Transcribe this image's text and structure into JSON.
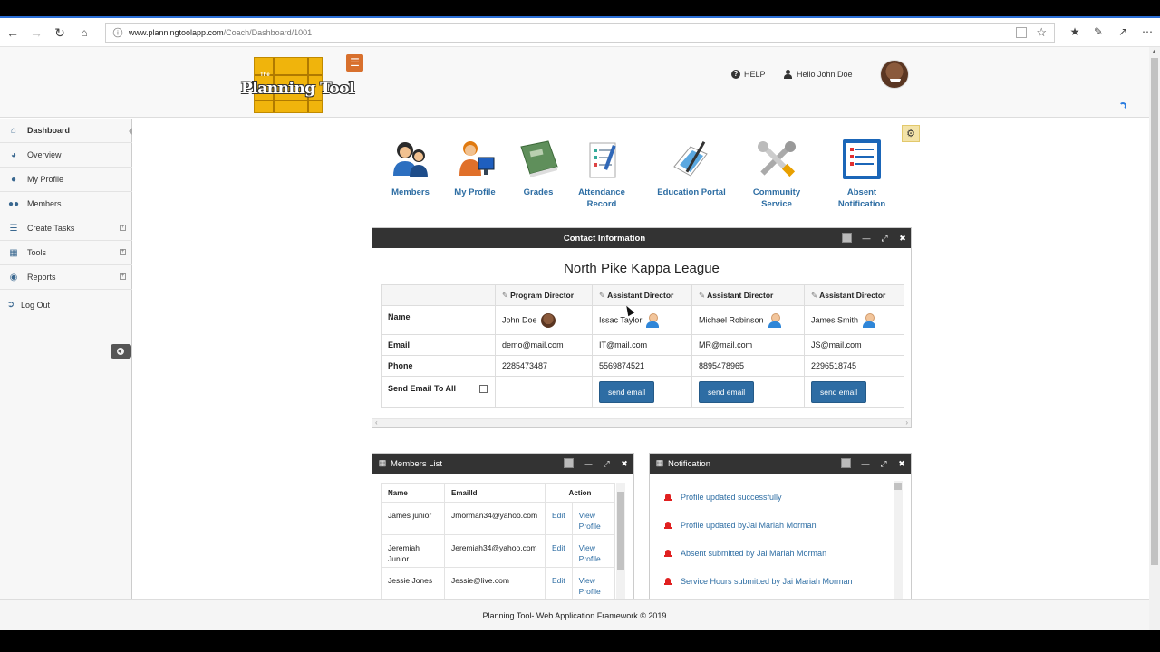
{
  "browser": {
    "url_host": "www.planningtoolapp.com",
    "url_path": "/Coach/Dashboard/1001"
  },
  "header": {
    "logo_small": "The",
    "logo_text": "Planning Tool",
    "help_label": "HELP",
    "greeting": "Hello John Doe"
  },
  "sidebar": {
    "items": [
      {
        "label": "Dashboard",
        "icon": "home-icon"
      },
      {
        "label": "Overview",
        "icon": "pie-icon"
      },
      {
        "label": "My Profile",
        "icon": "user-icon"
      },
      {
        "label": "Members",
        "icon": "users-icon"
      },
      {
        "label": "Create Tasks",
        "icon": "tasks-icon"
      },
      {
        "label": "Tools",
        "icon": "chart-icon"
      },
      {
        "label": "Reports",
        "icon": "reports-icon"
      },
      {
        "label": "Log Out",
        "icon": "logout-icon"
      }
    ]
  },
  "quick_links": [
    {
      "label": "Members"
    },
    {
      "label": "My Profile"
    },
    {
      "label": "Grades"
    },
    {
      "label": "Attendance",
      "label2": "Record"
    },
    {
      "label": "Education Portal"
    },
    {
      "label": "Community",
      "label2": "Service"
    },
    {
      "label": "Absent",
      "label2": "Notification"
    }
  ],
  "contact_panel": {
    "header": "Contact Information",
    "title": "North Pike Kappa League",
    "columns": [
      "Program Director",
      "Assistant Director",
      "Assistant Director",
      "Assistant Director"
    ],
    "row_labels": {
      "name": "Name",
      "email": "Email",
      "phone": "Phone",
      "send": "Send Email To All"
    },
    "people": [
      {
        "name": "John Doe",
        "email": "demo@mail.com",
        "phone": "2285473487"
      },
      {
        "name": "Issac Taylor",
        "email": "IT@mail.com",
        "phone": "5569874521",
        "button": "send email"
      },
      {
        "name": "Michael Robinson",
        "email": "MR@mail.com",
        "phone": "8895478965",
        "button": "send email"
      },
      {
        "name": "James Smith",
        "email": "JS@mail.com",
        "phone": "2296518745",
        "button": "send email"
      }
    ]
  },
  "members_panel": {
    "header": "Members List",
    "columns": [
      "Name",
      "EmailId",
      "Action"
    ],
    "edit_label": "Edit",
    "view_label_1": "View",
    "view_label_2": "Profile",
    "rows": [
      {
        "name1": "James junior",
        "name2": "",
        "email": "Jmorman34@yahoo.com"
      },
      {
        "name1": "Jeremiah",
        "name2": "Junior",
        "email": "Jeremiah34@yahoo.com"
      },
      {
        "name1": "Jessie Jones",
        "name2": "",
        "email": "Jessie@live.com"
      }
    ]
  },
  "notification_panel": {
    "header": "Notification",
    "items": [
      "Profile updated successfully",
      "Profile updated byJai Mariah Morman",
      "Absent submitted by Jai Mariah Morman",
      "Service Hours submitted by Jai Mariah Morman"
    ]
  },
  "footer": {
    "text": "Planning Tool- Web Application Framework © 2019"
  }
}
